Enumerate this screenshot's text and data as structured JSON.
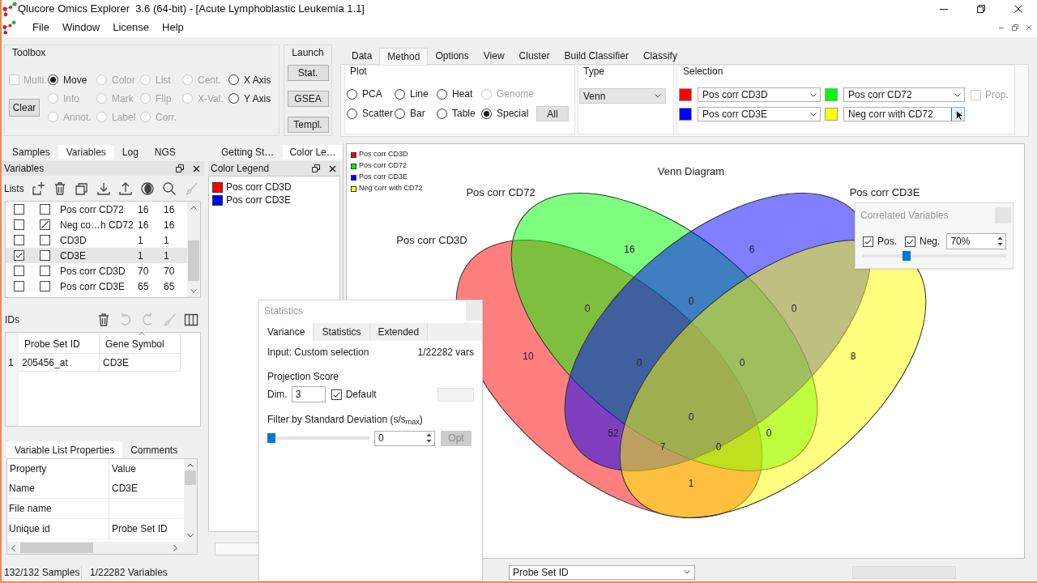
{
  "window": {
    "title": "Qlucore Omics Explorer  3.6 (64-bit) - [Acute Lymphoblastic Leukemia 1.1]"
  },
  "menu": [
    "File",
    "Window",
    "License",
    "Help"
  ],
  "toolbox": {
    "title": "Toolbox",
    "multi": {
      "label": "Multi.",
      "checked": false,
      "disabled": true
    },
    "clear_button": "Clear",
    "tool_rows": [
      [
        {
          "label": "Move",
          "selected": true,
          "disabled": false
        },
        {
          "label": "Color",
          "selected": false,
          "disabled": true
        },
        {
          "label": "List",
          "selected": false,
          "disabled": true
        },
        {
          "label": "Cent.",
          "selected": false,
          "disabled": true
        },
        {
          "label": "X Axis",
          "selected": false,
          "disabled": false
        }
      ],
      [
        {
          "label": "Info",
          "selected": false,
          "disabled": true
        },
        {
          "label": "Mark",
          "selected": false,
          "disabled": true
        },
        {
          "label": "Flip",
          "selected": false,
          "disabled": true
        },
        {
          "label": "X-Val.",
          "selected": false,
          "disabled": true
        },
        {
          "label": "Y Axis",
          "selected": false,
          "disabled": false
        }
      ],
      [
        {
          "label": "Annot.",
          "selected": false,
          "disabled": true
        },
        {
          "label": "Label",
          "selected": false,
          "disabled": true
        },
        {
          "label": "Corr.",
          "selected": false,
          "disabled": true
        }
      ]
    ]
  },
  "launch": {
    "title": "Launch",
    "buttons": [
      "Stat.",
      "GSEA",
      "Templ."
    ]
  },
  "ribbon": {
    "tabs": [
      {
        "label": "Data",
        "selected": false
      },
      {
        "label": "Method",
        "selected": true
      },
      {
        "label": "Options",
        "selected": false
      },
      {
        "label": "View",
        "selected": false
      },
      {
        "label": "Cluster",
        "selected": false
      },
      {
        "label": "Build Classifier",
        "selected": false
      },
      {
        "label": "Classify",
        "selected": false
      }
    ],
    "plot": {
      "title": "Plot",
      "option_rows": [
        [
          {
            "label": "PCA",
            "selected": false,
            "disabled": false
          },
          {
            "label": "Line",
            "selected": false,
            "disabled": false
          },
          {
            "label": "Heat",
            "selected": false,
            "disabled": false
          },
          {
            "label": "Genome",
            "selected": false,
            "disabled": true
          }
        ],
        [
          {
            "label": "Scatter",
            "selected": false,
            "disabled": false
          },
          {
            "label": "Bar",
            "selected": false,
            "disabled": false
          },
          {
            "label": "Table",
            "selected": false,
            "disabled": false
          },
          {
            "label": "Special",
            "selected": true,
            "disabled": false
          }
        ]
      ],
      "all_button": "All"
    },
    "type": {
      "title": "Type",
      "value": "Venn"
    },
    "selection": {
      "title": "Selection",
      "slots": [
        {
          "color": "#ff0000",
          "value": "Pos corr CD3D",
          "hovered": false
        },
        {
          "color": "#00ff00",
          "value": "Pos corr CD72",
          "hovered": false
        },
        {
          "color": "#0000ff",
          "value": "Pos corr CD3E",
          "hovered": false
        },
        {
          "color": "#ffff00",
          "value": "Neg corr with CD72",
          "hovered": true
        }
      ],
      "prop": {
        "label": "Prop.",
        "checked": false,
        "disabled": true
      }
    }
  },
  "side_tabs": [
    {
      "label": "Samples",
      "selected": false
    },
    {
      "label": "Variables",
      "selected": true
    },
    {
      "label": "Log",
      "selected": false
    },
    {
      "label": "NGS",
      "selected": false
    }
  ],
  "variables_panel": {
    "title": "Variables",
    "lists_label": "Lists",
    "lists": [
      {
        "checked": false,
        "slashed": false,
        "name": "Pos corr CD72",
        "column_4": "16",
        "column_5": "16",
        "selected": false
      },
      {
        "checked": false,
        "slashed": true,
        "name": "Neg co…h CD72",
        "column_4": "16",
        "column_5": "16",
        "selected": false
      },
      {
        "checked": false,
        "slashed": false,
        "name": "CD3D",
        "column_4": "1",
        "column_5": "1",
        "selected": false
      },
      {
        "checked": true,
        "slashed": false,
        "name": "CD3E",
        "column_4": "1",
        "column_5": "1",
        "selected": true
      },
      {
        "checked": false,
        "slashed": false,
        "name": "Pos corr CD3D",
        "column_4": "70",
        "column_5": "70",
        "selected": false
      },
      {
        "checked": false,
        "slashed": false,
        "name": "Pos corr CD3E",
        "column_4": "65",
        "column_5": "65",
        "selected": false
      }
    ]
  },
  "ids_panel": {
    "title": "IDs",
    "columns": [
      "Probe Set ID",
      "Gene Symbol"
    ],
    "rows": [
      {
        "number": "1",
        "cells": [
          "205456_at",
          "CD3E"
        ]
      }
    ]
  },
  "properties_panel": {
    "tabs": [
      {
        "label": "Variable List Properties",
        "selected": true
      },
      {
        "label": "Comments",
        "selected": false
      }
    ],
    "columns": [
      "Property",
      "Value"
    ],
    "rows": [
      {
        "property": "Name",
        "value": "CD3E"
      },
      {
        "property": "File name"
      },
      {
        "property": "Unique id",
        "value": "Probe Set ID"
      }
    ]
  },
  "dock_tabs": [
    {
      "label": "Getting St…",
      "selected": false
    },
    {
      "label": "Color Le…",
      "selected": true
    }
  ],
  "color_legend": {
    "title": "Color Legend",
    "items": [
      {
        "label": "Pos corr CD3D",
        "color": "#ff0000"
      },
      {
        "label": "Pos corr CD3E",
        "color": "#0000ff"
      }
    ]
  },
  "venn_view": {
    "title": "Venn Diagram",
    "legend": [
      {
        "label": "Pos corr CD3D",
        "color": "#ff0000"
      },
      {
        "label": "Pos corr CD72",
        "color": "#00ff00"
      },
      {
        "label": "Pos corr CD3E",
        "color": "#0000ff"
      },
      {
        "label": "Neg corr with CD72",
        "color": "#ffff00"
      }
    ],
    "set_labels": [
      "Pos corr CD72",
      "Pos corr CD3E",
      "Pos corr CD3D"
    ],
    "region_counts": [
      "10",
      "16",
      "6",
      "8",
      "0",
      "0",
      "0",
      "0",
      "0",
      "0",
      "52",
      "0",
      "7",
      "0",
      "1"
    ]
  },
  "correlated_variables": {
    "title": "Correlated Variables",
    "options": [
      {
        "label": "Pos.",
        "checked": true
      },
      {
        "label": "Neg.",
        "checked": true
      }
    ],
    "threshold": "70%",
    "slider": {
      "level": 0.3
    }
  },
  "statistics_dialog": {
    "title": "Statistics",
    "tabs": [
      {
        "label": "Variance",
        "selected": true
      },
      {
        "label": "Statistics",
        "selected": false
      },
      {
        "label": "Extended",
        "selected": false
      }
    ],
    "input_label": "Input: Custom selection",
    "input_count": "1/22282 vars",
    "projection": {
      "title": "Projection Score",
      "dim_label": "Dim.",
      "dim_value": "3",
      "default": {
        "label": "Default",
        "checked": true
      }
    },
    "filter": {
      "title": "Filter by Standard Deviation (s/s$_{max}$)",
      "slider": {
        "level": 0
      },
      "value": "0",
      "opt_button": {
        "label": "Opt",
        "disabled": true
      }
    }
  },
  "status_bar": {
    "samples": "132/132 Samples",
    "variables": "1/22282 Variables",
    "id_column": "Probe Set ID"
  }
}
